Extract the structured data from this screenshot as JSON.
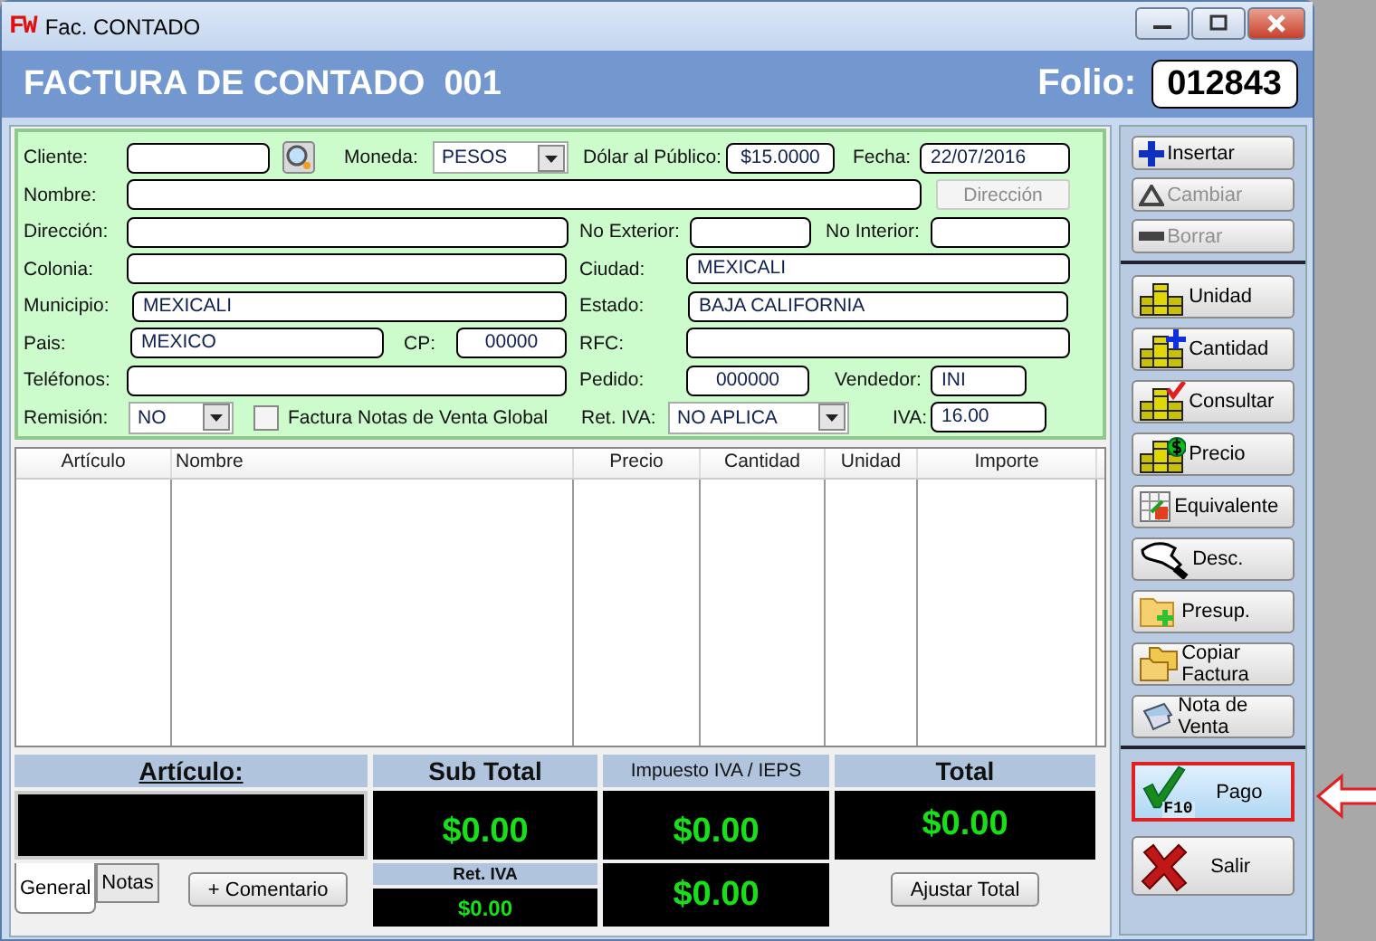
{
  "window": {
    "logo": "FW",
    "title": "Fac. CONTADO"
  },
  "header": {
    "title": "FACTURA DE CONTADO  001",
    "folio_label": "Folio:",
    "folio": "012843"
  },
  "form": {
    "address_button": {
      "label": "Dirección",
      "disabled": true
    },
    "lines": [
      {
        "items": [
          {
            "kind": "label",
            "text": "Cliente:"
          },
          {
            "kind": "field"
          },
          {
            "kind": "search"
          },
          {
            "kind": "label",
            "text": "Moneda:"
          },
          {
            "kind": "combo",
            "value": "PESOS"
          },
          {
            "kind": "label",
            "text": "Dólar al Público:"
          },
          {
            "kind": "field",
            "value": "$15.0000"
          },
          {
            "kind": "label",
            "text": "Fecha:"
          },
          {
            "kind": "field",
            "value": "22/07/2016"
          }
        ]
      },
      {
        "items": [
          {
            "kind": "label",
            "text": "Nombre:"
          },
          {
            "kind": "field"
          }
        ]
      },
      {
        "items": [
          {
            "kind": "label",
            "text": "Dirección:"
          },
          {
            "kind": "field"
          },
          {
            "kind": "label",
            "text": "No Exterior:"
          },
          {
            "kind": "field"
          },
          {
            "kind": "label",
            "text": "No Interior:"
          },
          {
            "kind": "field"
          }
        ]
      },
      {
        "items": [
          {
            "kind": "label",
            "text": "Colonia:"
          },
          {
            "kind": "field"
          },
          {
            "kind": "label",
            "text": "Ciudad:"
          },
          {
            "kind": "field",
            "value": "MEXICALI"
          }
        ]
      },
      {
        "items": [
          {
            "kind": "label",
            "text": "Municipio:"
          },
          {
            "kind": "field",
            "value": "MEXICALI"
          },
          {
            "kind": "label",
            "text": "Estado:"
          },
          {
            "kind": "field",
            "value": "BAJA CALIFORNIA"
          }
        ]
      },
      {
        "items": [
          {
            "kind": "label",
            "text": "Pais:"
          },
          {
            "kind": "field",
            "value": "MEXICO"
          },
          {
            "kind": "label",
            "text": "CP:"
          },
          {
            "kind": "field",
            "value": "00000"
          },
          {
            "kind": "label",
            "text": "RFC:"
          },
          {
            "kind": "field"
          }
        ]
      },
      {
        "items": [
          {
            "kind": "label",
            "text": "Teléfonos:"
          },
          {
            "kind": "field"
          },
          {
            "kind": "label",
            "text": "Pedido:"
          },
          {
            "kind": "field",
            "value": "000000"
          },
          {
            "kind": "label",
            "text": "Vendedor:"
          },
          {
            "kind": "field",
            "value": "INI"
          }
        ]
      },
      {
        "items": [
          {
            "kind": "label",
            "text": "Remisión:"
          },
          {
            "kind": "combo",
            "value": "NO"
          },
          {
            "kind": "checkbox",
            "label": "Factura Notas de Venta Global",
            "checked": false
          },
          {
            "kind": "label",
            "text": "Ret. IVA:"
          },
          {
            "kind": "combo",
            "value": "NO APLICA"
          },
          {
            "kind": "label",
            "text": "IVA:"
          },
          {
            "kind": "field",
            "value": "16.00"
          }
        ]
      }
    ]
  },
  "table": {
    "columns": [
      "Artículo",
      "Nombre",
      "Precio",
      "Cantidad",
      "Unidad",
      "Importe"
    ]
  },
  "totals": {
    "articulo_label": "Artículo:",
    "subtotal_label": "Sub Total",
    "subtotal": "$0.00",
    "impuesto_label": "Impuesto IVA / IEPS",
    "impuesto": "$0.00",
    "total_label": "Total",
    "total": "$0.00",
    "ret_label": "Ret. IVA",
    "ret": "$0.00",
    "impuesto_2": "$0.00"
  },
  "tabs": [
    {
      "label": "General",
      "selected": true
    },
    {
      "label": "Notas",
      "selected": false
    }
  ],
  "comentario_button": "+ Comentario",
  "ajustar_button": "Ajustar Total",
  "sidebar": {
    "groups": [
      [
        {
          "label": "Insertar",
          "disabled": false
        },
        {
          "label": "Cambiar",
          "disabled": true
        },
        {
          "label": "Borrar",
          "disabled": true
        }
      ],
      [
        {
          "label": "Unidad",
          "disabled": false
        },
        {
          "label": "Cantidad",
          "disabled": false
        },
        {
          "label": "Consultar",
          "disabled": false
        },
        {
          "label": "Precio",
          "disabled": false
        },
        {
          "label": "Equivalente",
          "disabled": false
        },
        {
          "label": "Desc.",
          "disabled": false
        },
        {
          "label": "Presup.",
          "disabled": false
        },
        {
          "label": "Copiar Factura",
          "disabled": false
        },
        {
          "label": "Nota de Venta",
          "disabled": false
        }
      ],
      [
        {
          "label": "Pago",
          "shortcut": "F10",
          "disabled": false,
          "highlighted": true
        },
        {
          "label": "Salir",
          "disabled": false,
          "highlighted": false
        }
      ]
    ]
  }
}
